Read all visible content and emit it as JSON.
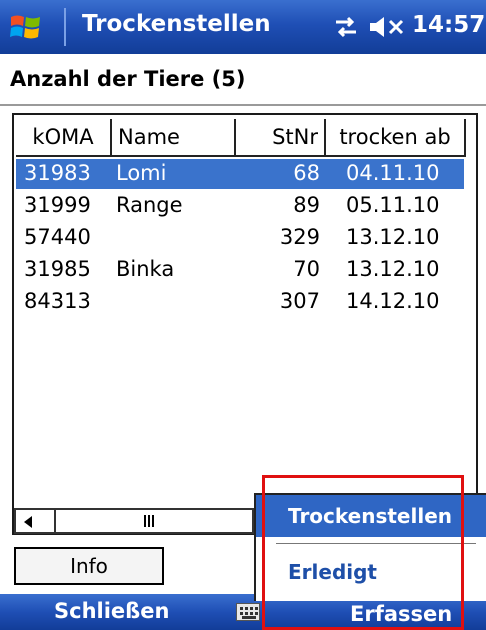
{
  "titlebar": {
    "title": "Trockenstellen",
    "clock": "14:57",
    "icons": [
      "windows-start-icon",
      "connectivity-icon",
      "speaker-mute-icon"
    ]
  },
  "header": {
    "title": "Anzahl der Tiere (5)"
  },
  "table": {
    "columns": [
      "kOMA",
      "Name",
      "StNr",
      "trocken ab"
    ],
    "rows": [
      {
        "koma": "31983",
        "name": "Lomi",
        "stnr": "68",
        "date": "04.11.10",
        "selected": true
      },
      {
        "koma": "31999",
        "name": "Range",
        "stnr": "89",
        "date": "05.11.10",
        "selected": false
      },
      {
        "koma": "57440",
        "name": "",
        "stnr": "329",
        "date": "13.12.10",
        "selected": false
      },
      {
        "koma": "31985",
        "name": "Binka",
        "stnr": "70",
        "date": "13.12.10",
        "selected": false
      },
      {
        "koma": "84313",
        "name": "",
        "stnr": "307",
        "date": "14.12.10",
        "selected": false
      }
    ]
  },
  "info_button": "Info",
  "menu": {
    "items": [
      "Trockenstellen",
      "Erledigt"
    ],
    "highlighted_index": 0
  },
  "softkeys": {
    "left": "Schließen",
    "right": "Erfassen"
  },
  "colors": {
    "accent": "#1f4fb5",
    "selection": "#3a73cc",
    "annotation": "#e01010"
  }
}
